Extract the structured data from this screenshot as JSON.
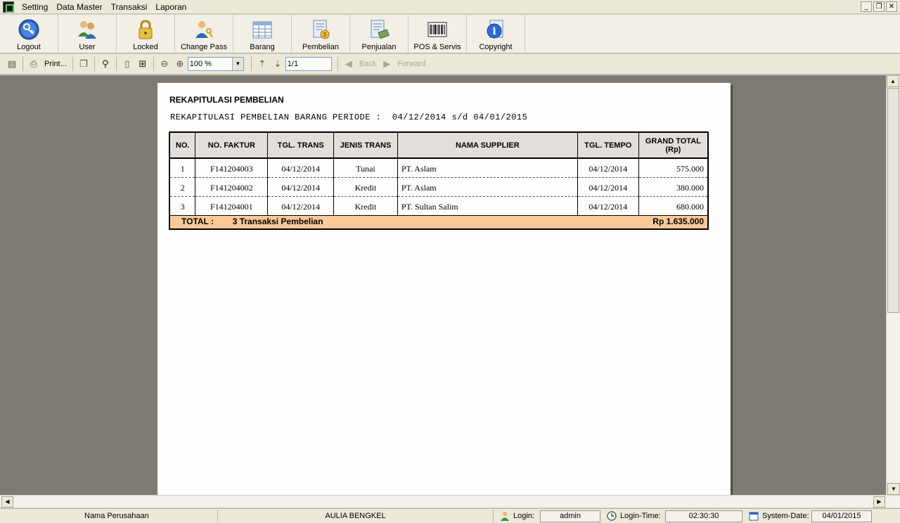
{
  "menubar": {
    "items": [
      "Setting",
      "Data Master",
      "Transaksi",
      "Laporan"
    ]
  },
  "toolbar": {
    "buttons": [
      {
        "label": "Logout",
        "icon": "key-icon"
      },
      {
        "label": "User",
        "icon": "users-icon"
      },
      {
        "label": "Locked",
        "icon": "lock-icon"
      },
      {
        "label": "Change Pass",
        "icon": "user-key-icon"
      },
      {
        "label": "Barang",
        "icon": "inventory-grid-icon"
      },
      {
        "label": "Pembelian",
        "icon": "purchase-document-icon"
      },
      {
        "label": "Penjualan",
        "icon": "sales-document-icon"
      },
      {
        "label": "POS & Servis",
        "icon": "barcode-icon"
      },
      {
        "label": "Copyright",
        "icon": "info-icon"
      }
    ]
  },
  "preview_toolbar": {
    "print_label": "Print...",
    "zoom_value": "100 %",
    "page_value": "1/1",
    "back_label": "Back",
    "forward_label": "Forward"
  },
  "report": {
    "title": "REKAPITULASI PEMBELIAN",
    "subtitle": "REKAPITULASI PEMBELIAN BARANG PERIODE :  04/12/2014 s/d 04/01/2015",
    "columns": [
      "NO.",
      "NO. FAKTUR",
      "TGL. TRANS",
      "JENIS TRANS",
      "NAMA SUPPLIER",
      "TGL. TEMPO",
      "GRAND TOTAL\n(Rp)"
    ],
    "rows": [
      {
        "no": "1",
        "faktur": "F141204003",
        "tgl_trans": "04/12/2014",
        "jenis": "Tunai",
        "supplier": "PT. Aslam",
        "tempo": "04/12/2014",
        "total": "575.000"
      },
      {
        "no": "2",
        "faktur": "F141204002",
        "tgl_trans": "04/12/2014",
        "jenis": "Kredit",
        "supplier": "PT. Aslam",
        "tempo": "04/12/2014",
        "total": "380.000"
      },
      {
        "no": "3",
        "faktur": "F141204001",
        "tgl_trans": "04/12/2014",
        "jenis": "Kredit",
        "supplier": "PT. Sultan Salim",
        "tempo": "04/12/2014",
        "total": "680.000"
      }
    ],
    "total_label": "TOTAL :",
    "total_count": "3 Transaksi Pembelian",
    "total_value": "Rp 1.635.000",
    "total_row_color": "#fbc996"
  },
  "statusbar": {
    "company_label": "Nama Perusahaan",
    "company_value": "AULIA BENGKEL",
    "login_label": "Login:",
    "login_value": "admin",
    "login_time_label": "Login-Time:",
    "login_time_value": "02:30:30",
    "system_date_label": "System-Date:",
    "system_date_value": "04/01/2015"
  }
}
